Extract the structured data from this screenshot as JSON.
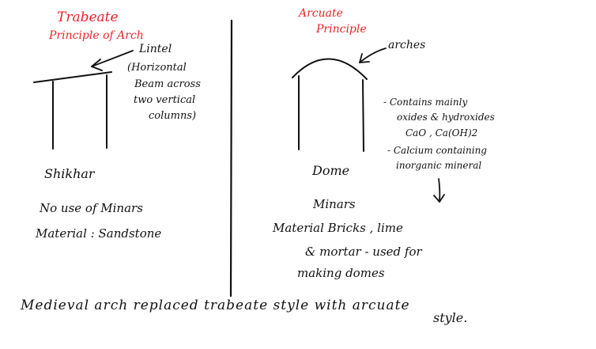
{
  "colors": {
    "ink": "#111111",
    "heading": "#e8262a",
    "background": "#ffffff"
  },
  "left": {
    "heading_line1": "Trabeate",
    "heading_line2": "Principle of Arch",
    "lintel_label": "Lintel",
    "lintel_note_line1": "(Horizontal",
    "lintel_note_line2": "Beam across",
    "lintel_note_line3": "two vertical",
    "lintel_note_line4": "columns)",
    "line1": "Shikhar",
    "line2": "No use of Minars",
    "line3": "Material : Sandstone"
  },
  "right": {
    "heading_line1": "Arcuate",
    "heading_line2": "Principle",
    "arches_label": "arches",
    "note_line1": "- Contains mainly",
    "note_line2": "oxides & hydroxides",
    "note_line3": "CaO , Ca(OH)2",
    "note_line4": "- Calcium containing",
    "note_line5": "inorganic mineral",
    "line1": "Dome",
    "line2": "Minars",
    "line3": "Material  Bricks , lime",
    "line4": "& mortar - used for",
    "line5": "making domes"
  },
  "bottom": {
    "line1": "Medieval arch replaced trabeate style with arcuate",
    "line2": "style."
  }
}
